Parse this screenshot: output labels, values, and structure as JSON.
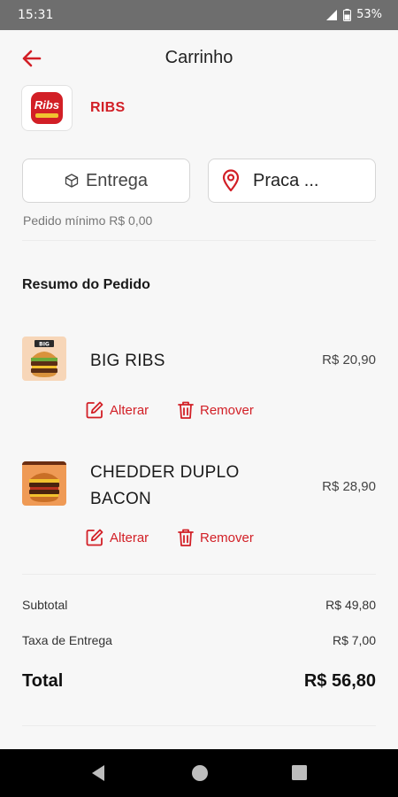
{
  "status_bar": {
    "time": "15:31",
    "battery": "53%"
  },
  "header": {
    "title": "Carrinho"
  },
  "restaurant": {
    "name": "RIBS",
    "logo_text": "Ribs"
  },
  "options": {
    "delivery_label": "Entrega",
    "location_label": "Praca ..."
  },
  "min_order": "Pedido mínimo R$ 0,00",
  "order_summary": {
    "title": "Resumo do Pedido",
    "items": [
      {
        "name": "BIG RIBS",
        "price": "R$ 20,90",
        "edit_label": "Alterar",
        "remove_label": "Remover"
      },
      {
        "name_line1": "CHEDDER DUPLO",
        "name_line2": "BACON",
        "price": "R$ 28,90",
        "edit_label": "Alterar",
        "remove_label": "Remover"
      }
    ]
  },
  "totals": {
    "subtotal_label": "Subtotal",
    "subtotal_value": "R$ 49,80",
    "delivery_fee_label": "Taxa de Entrega",
    "delivery_fee_value": "R$ 7,00",
    "total_label": "Total",
    "total_value": "R$ 56,80"
  },
  "icons": {
    "back": "arrow-left-icon",
    "delivery": "package-icon",
    "location": "map-pin-icon",
    "edit": "edit-icon",
    "remove": "trash-icon"
  },
  "colors": {
    "accent": "#d21f26",
    "background": "#f7f7f7",
    "status_bar": "#6e6e6e"
  }
}
